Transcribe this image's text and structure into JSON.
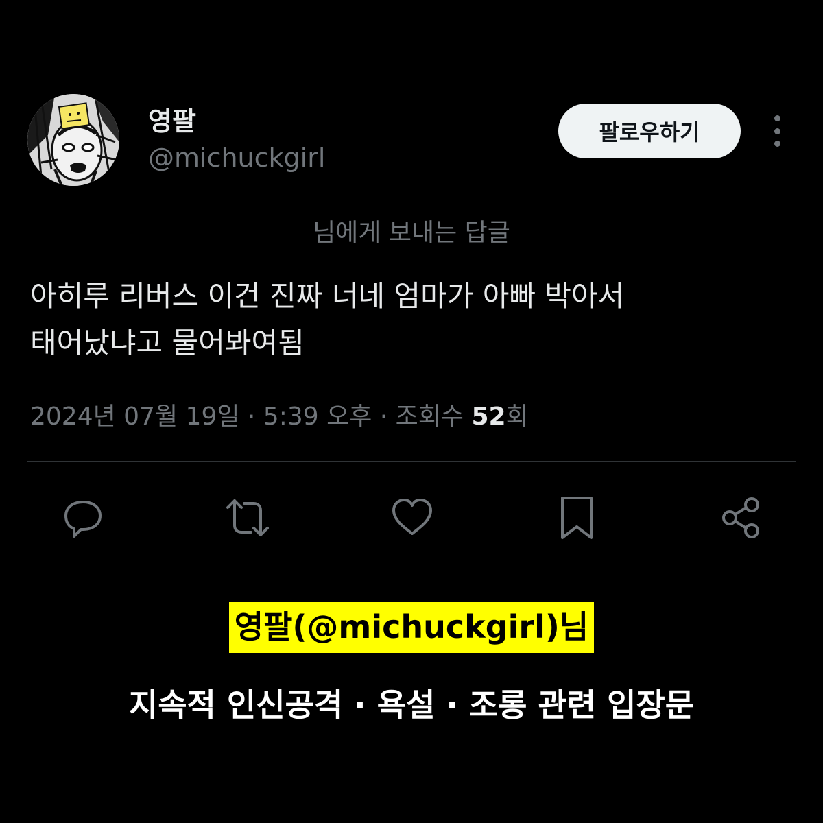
{
  "tweet": {
    "author": {
      "display_name": "영팔",
      "handle": "@michuckgirl",
      "avatar": "manga-character-avatar"
    },
    "follow_label": "팔로우하기",
    "more_icon": "more-vertical-icon",
    "reply_context": "님에게 보내는 답글",
    "text_lines": [
      "아히루 리버스 이건 진짜 너네 엄마가 아빠 박아서",
      "태어났냐고 물어봐여됨"
    ],
    "meta": {
      "datetime": "2024년 07월 19일 · 5:39 오후 · 조회수 ",
      "views_count": "52",
      "views_suffix": "회"
    },
    "actions": [
      {
        "name": "reply",
        "icon": "speech-bubble-icon"
      },
      {
        "name": "retweet",
        "icon": "retweet-icon"
      },
      {
        "name": "like",
        "icon": "heart-icon"
      },
      {
        "name": "bookmark",
        "icon": "bookmark-icon"
      },
      {
        "name": "share",
        "icon": "share-icon"
      }
    ]
  },
  "caption": {
    "highlight": "영팔(@michuckgirl)님",
    "subtitle": "지속적 인신공격 · 욕설 · 조롱 관련 입장문"
  },
  "colors": {
    "background": "#000000",
    "primary_text": "#e7e9ea",
    "secondary_text": "#71767b",
    "divider": "#2f3336",
    "highlight": "#ffff00"
  }
}
